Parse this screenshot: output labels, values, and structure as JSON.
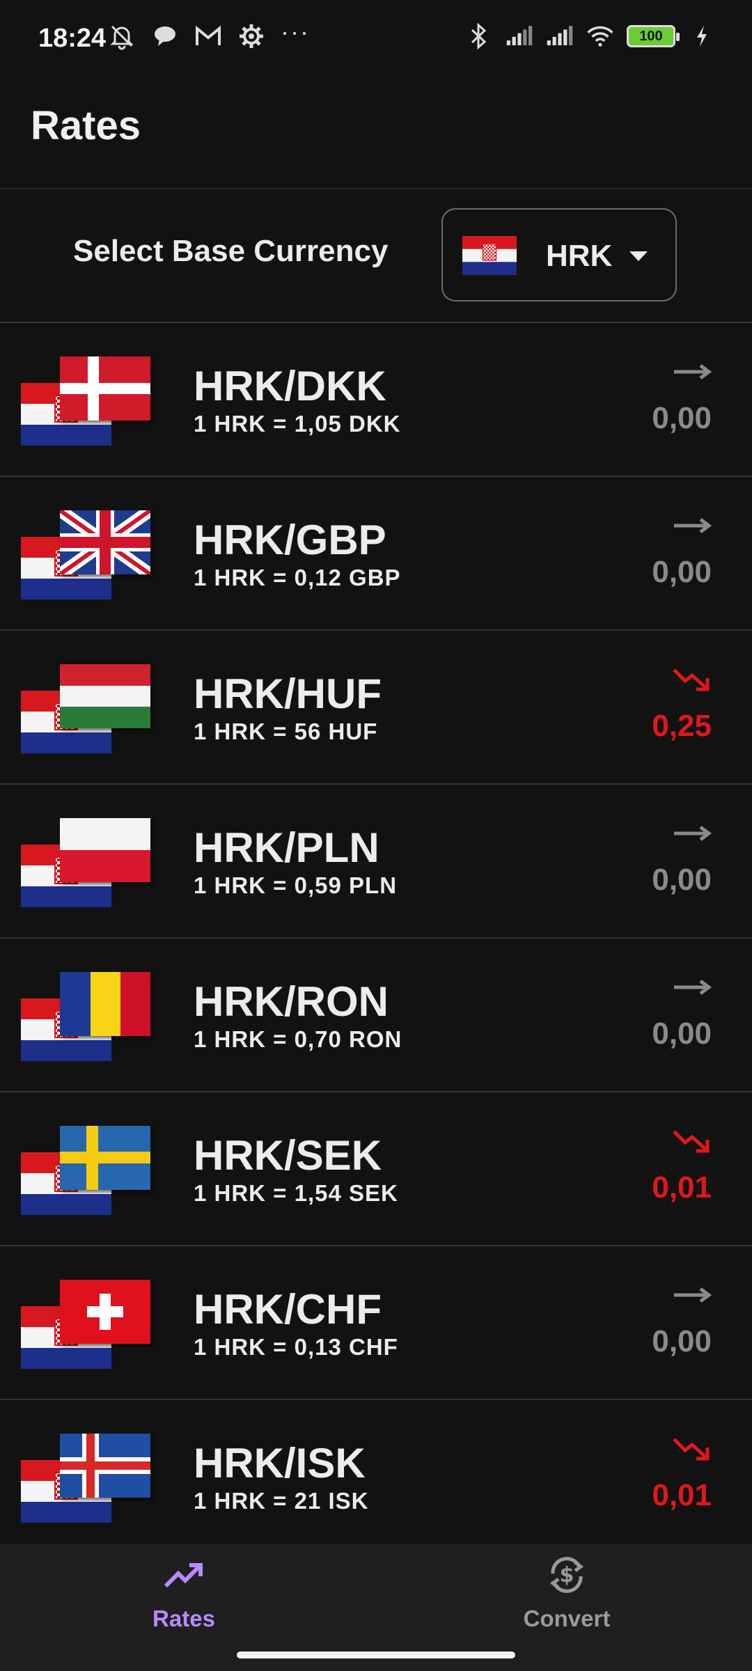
{
  "status_bar": {
    "time": "18:24",
    "battery_level": "100",
    "left_icons": [
      "bell-off-icon",
      "chat-bubble-icon",
      "gmail-icon",
      "gear-icon",
      "more-dots-icon"
    ],
    "right_icons": [
      "bluetooth-icon",
      "signal-icon",
      "signal-icon",
      "wifi-icon",
      "battery-icon",
      "charging-icon"
    ]
  },
  "app_bar": {
    "title": "Rates"
  },
  "base_currency": {
    "label": "Select Base Currency",
    "code": "HRK",
    "flag": "croatia-flag"
  },
  "rates": [
    {
      "pair": "HRK/DKK",
      "rate": "1 HRK = 1,05 DKK",
      "change": "0,00",
      "trend": "flat",
      "flag": "denmark-flag"
    },
    {
      "pair": "HRK/GBP",
      "rate": "1 HRK = 0,12 GBP",
      "change": "0,00",
      "trend": "flat",
      "flag": "uk-flag"
    },
    {
      "pair": "HRK/HUF",
      "rate": "1 HRK = 56 HUF",
      "change": "0,25",
      "trend": "down",
      "flag": "hungary-flag"
    },
    {
      "pair": "HRK/PLN",
      "rate": "1 HRK = 0,59 PLN",
      "change": "0,00",
      "trend": "flat",
      "flag": "poland-flag"
    },
    {
      "pair": "HRK/RON",
      "rate": "1 HRK = 0,70 RON",
      "change": "0,00",
      "trend": "flat",
      "flag": "romania-flag"
    },
    {
      "pair": "HRK/SEK",
      "rate": "1 HRK = 1,54 SEK",
      "change": "0,01",
      "trend": "down",
      "flag": "sweden-flag"
    },
    {
      "pair": "HRK/CHF",
      "rate": "1 HRK = 0,13 CHF",
      "change": "0,00",
      "trend": "flat",
      "flag": "switzerland-flag"
    },
    {
      "pair": "HRK/ISK",
      "rate": "1 HRK = 21 ISK",
      "change": "0,01",
      "trend": "down",
      "flag": "iceland-flag"
    }
  ],
  "bottom_nav": {
    "rates_label": "Rates",
    "convert_label": "Convert",
    "active": "rates"
  },
  "colors": {
    "background": "#121212",
    "accent": "#b88aff",
    "down": "#e0181b",
    "neutral": "#8a8a8a"
  }
}
